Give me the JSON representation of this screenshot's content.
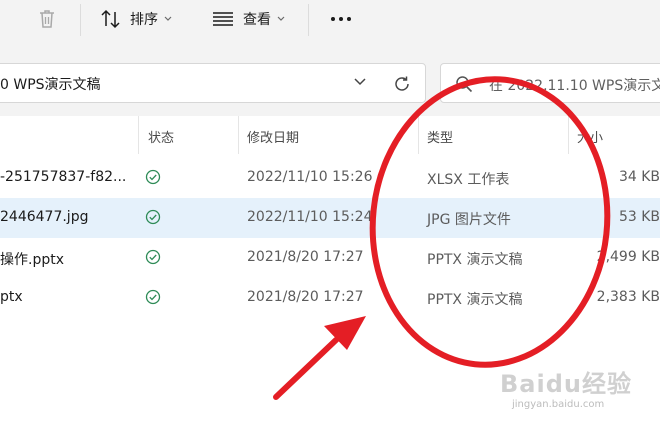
{
  "toolbar": {
    "sort_label": "排序",
    "view_label": "查看"
  },
  "address": {
    "path_text": "0 WPS演示文稿"
  },
  "search": {
    "placeholder": "在 2022.11.10 WPS演示文"
  },
  "columns": {
    "status": "状态",
    "date": "修改日期",
    "type": "类型",
    "size": "大小"
  },
  "files": [
    {
      "name": "-251757837-f82...",
      "date": "2022/11/10 15:26",
      "type": "XLSX 工作表",
      "size": "34 KB"
    },
    {
      "name": "2446477.jpg",
      "date": "2022/11/10 15:24",
      "type": "JPG 图片文件",
      "size": "53 KB"
    },
    {
      "name": "操作.pptx",
      "date": "2021/8/20 17:27",
      "type": "PPTX 演示文稿",
      "size": "2,499 KB"
    },
    {
      "name": "ptx",
      "date": "2021/8/20 17:27",
      "type": "PPTX 演示文稿",
      "size": "2,383 KB"
    }
  ],
  "watermark": {
    "brand": "Baidu经验",
    "url": "jingyan.baidu.com"
  },
  "colors": {
    "annotation_red": "#e41e25",
    "status_green": "#2e8b57",
    "selection_blue": "#e5f1fb"
  },
  "icons": [
    "trash-icon",
    "sort-icon",
    "view-list-icon",
    "more-icon",
    "chevron-down-icon",
    "refresh-icon",
    "search-icon",
    "check-circle-icon"
  ]
}
